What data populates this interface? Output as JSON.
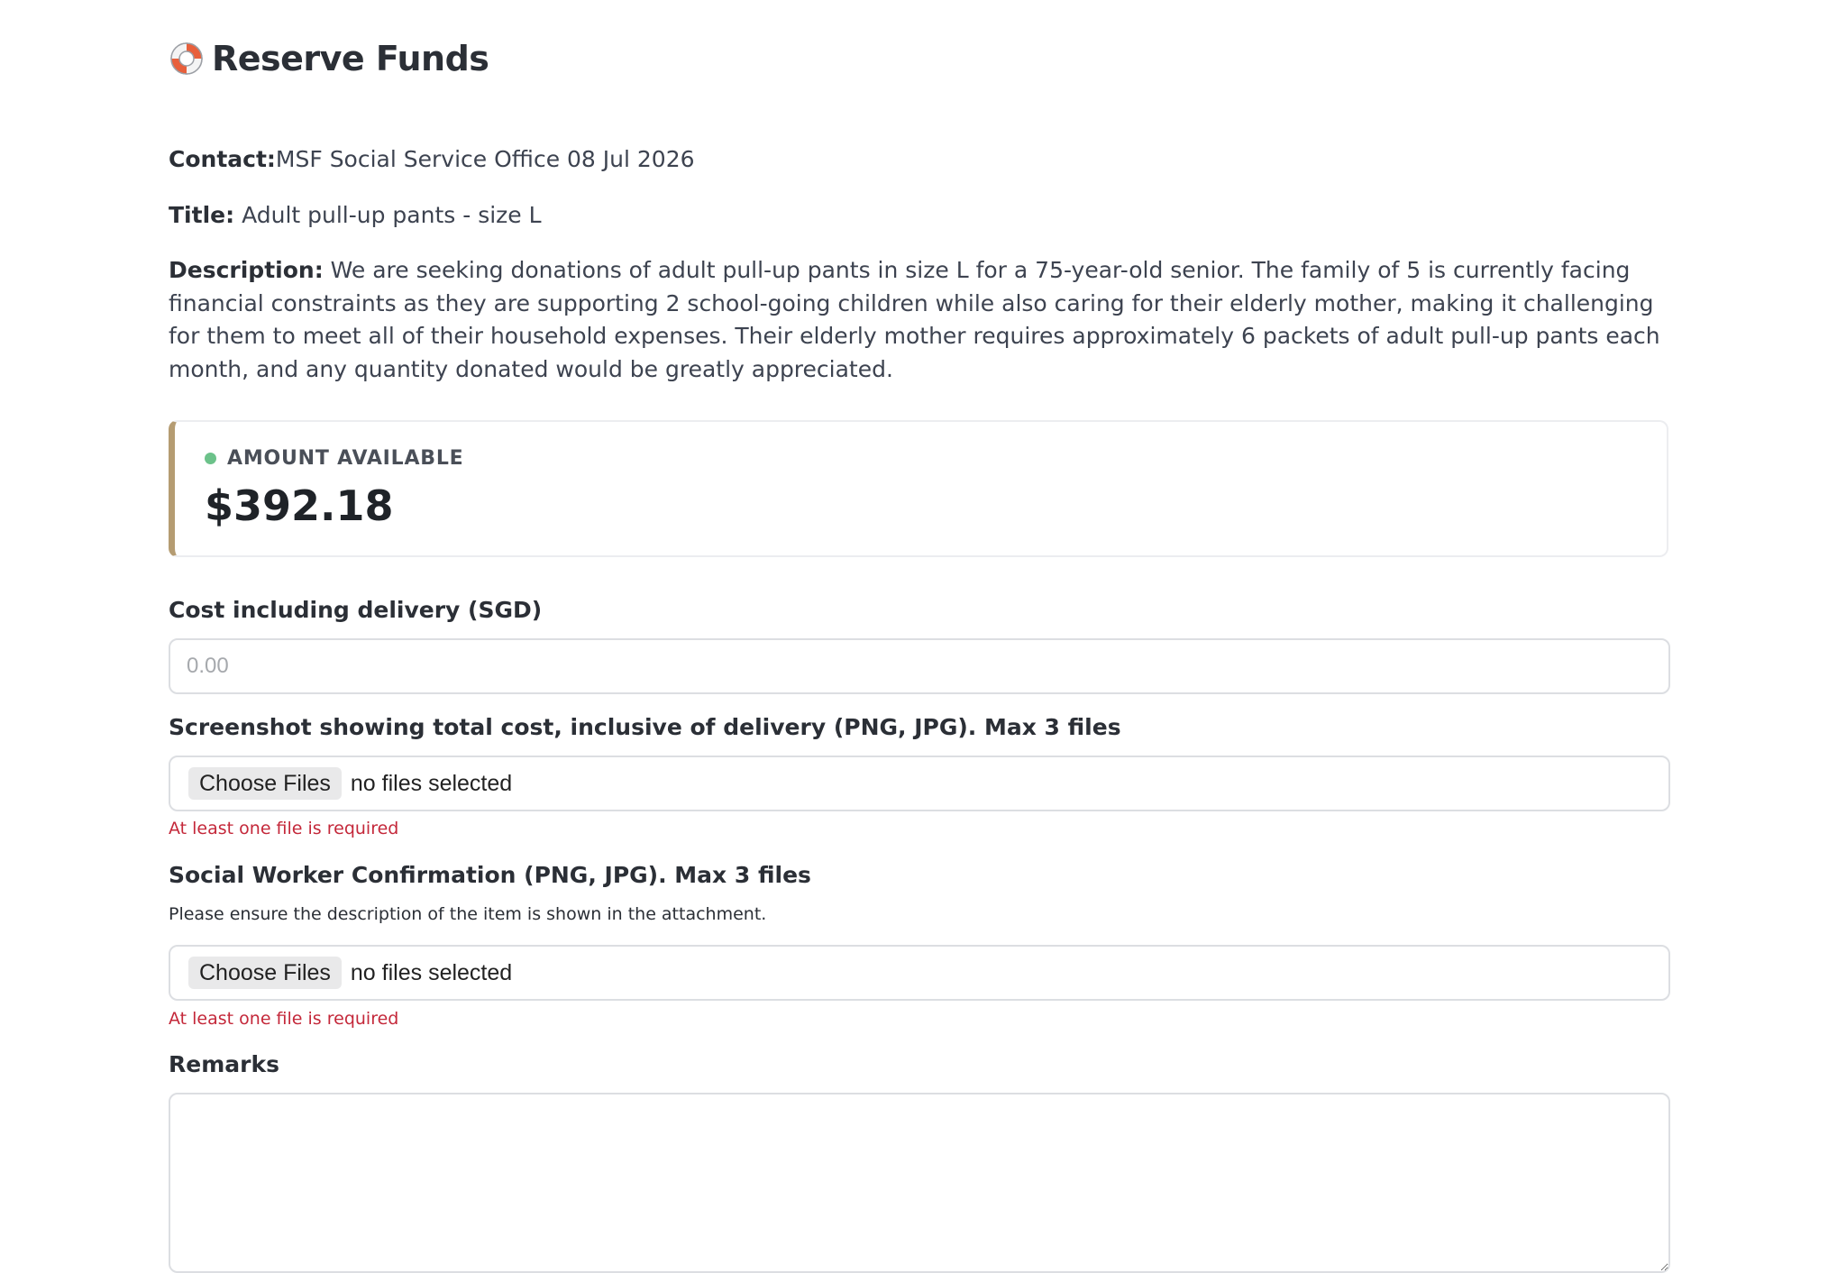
{
  "header": {
    "title": "Reserve Funds",
    "icon": "lifebuoy-icon"
  },
  "request": {
    "contact_label": "Contact:",
    "contact_value": "MSF Social Service Office 08 Jul 2026",
    "title_label": "Title:",
    "title_value": "Adult pull-up pants - size L",
    "description_label": "Description:",
    "description_value": "We are seeking donations of adult pull-up pants in size L for a 75-year-old senior. The family of 5 is currently facing financial constraints as they are supporting 2 school-going children while also caring for their elderly mother, making it challenging for them to meet all of their household expenses. Their elderly mother requires approximately 6 packets of adult pull-up pants each month, and any quantity donated would be greatly appreciated."
  },
  "amount_card": {
    "label": "AMOUNT AVAILABLE",
    "value": "$392.18",
    "status_color": "#6cc28a",
    "accent_color": "#b59c72"
  },
  "form": {
    "cost": {
      "label": "Cost including delivery (SGD)",
      "value": "",
      "placeholder": "0.00"
    },
    "screenshot": {
      "label": "Screenshot showing total cost, inclusive of delivery (PNG, JPG). Max 3 files",
      "button_label": "Choose Files",
      "status": "no files selected",
      "error": "At least one file is required"
    },
    "confirmation": {
      "label": "Social Worker Confirmation (PNG, JPG). Max 3 files",
      "help": "Please ensure the description of the item is shown in the attachment.",
      "button_label": "Choose Files",
      "status": "no files selected",
      "error": "At least one file is required"
    },
    "remarks": {
      "label": "Remarks",
      "value": ""
    }
  },
  "colors": {
    "error": "#c4283a",
    "text": "#2b2f36"
  }
}
